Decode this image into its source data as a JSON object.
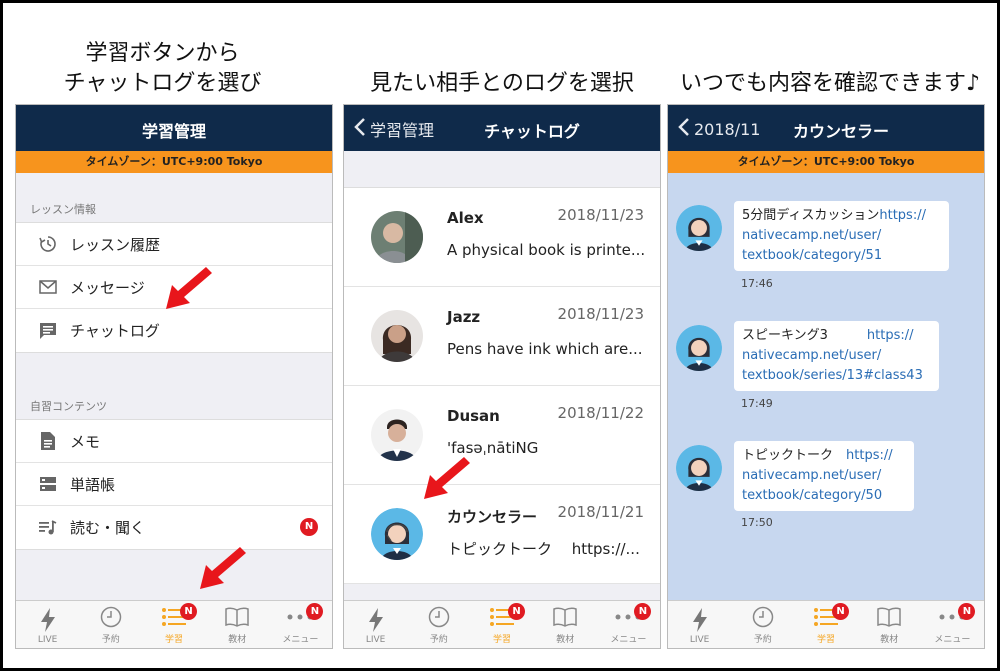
{
  "captions": {
    "left_line1": "学習ボタンから",
    "left_line2": "チャットログを選び",
    "middle": "見たい相手とのログを選択",
    "right": "いつでも内容を確認できます♪"
  },
  "tabbar": {
    "tabs": [
      {
        "label": "LIVE",
        "icon": "lightning-icon"
      },
      {
        "label": "予約",
        "icon": "clock-icon"
      },
      {
        "label": "学習",
        "icon": "list-icon",
        "badge": "N"
      },
      {
        "label": "教材",
        "icon": "book-icon"
      },
      {
        "label": "メニュー",
        "icon": "more-icon",
        "badge": "N"
      }
    ],
    "active_color": "#f5a623"
  },
  "screen1": {
    "title": "学習管理",
    "timezone": "タイムゾーン：UTC+9:00 Tokyo",
    "section1_label": "レッスン情報",
    "section1_items": [
      {
        "label": "レッスン履歴",
        "icon": "history-icon"
      },
      {
        "label": "メッセージ",
        "icon": "mail-icon"
      },
      {
        "label": "チャットログ",
        "icon": "chat-icon"
      }
    ],
    "section2_label": "自習コンテンツ",
    "section2_items": [
      {
        "label": "メモ",
        "icon": "document-icon"
      },
      {
        "label": "単語帳",
        "icon": "cards-icon"
      },
      {
        "label": "読む・聞く",
        "icon": "music-list-icon",
        "badge": "N"
      }
    ]
  },
  "screen2": {
    "back_label": "学習管理",
    "title": "チャットログ",
    "chats": [
      {
        "name": "Alex",
        "date": "2018/11/23",
        "preview": "A physical book is printe..."
      },
      {
        "name": "Jazz",
        "date": "2018/11/23",
        "preview": "Pens have ink which are..."
      },
      {
        "name": "Dusan",
        "date": "2018/11/22",
        "preview": "'fasəˌnātiNG"
      },
      {
        "name": "カウンセラー",
        "date": "2018/11/21",
        "preview": "トピックトーク　 https://..."
      }
    ]
  },
  "screen3": {
    "back_label": "2018/11",
    "title": "カウンセラー",
    "timezone": "タイムゾーン：UTC+9:00 Tokyo",
    "background_color": "#c7d7ef",
    "messages": [
      {
        "line1_text": "5分間ディスカッション",
        "line1_link": "https://",
        "line2": "nativecamp.net/user/",
        "line3": "textbook/category/51",
        "time": "17:46"
      },
      {
        "line1_text": "スピーキング3　　　",
        "line1_link": "https://",
        "line2": "nativecamp.net/user/",
        "line3": "textbook/series/13#class43",
        "time": "17:49"
      },
      {
        "line1_text": "トピックトーク　",
        "line1_link": "https://",
        "line2": "nativecamp.net/user/",
        "line3": "textbook/category/50",
        "time": "17:50"
      }
    ]
  }
}
